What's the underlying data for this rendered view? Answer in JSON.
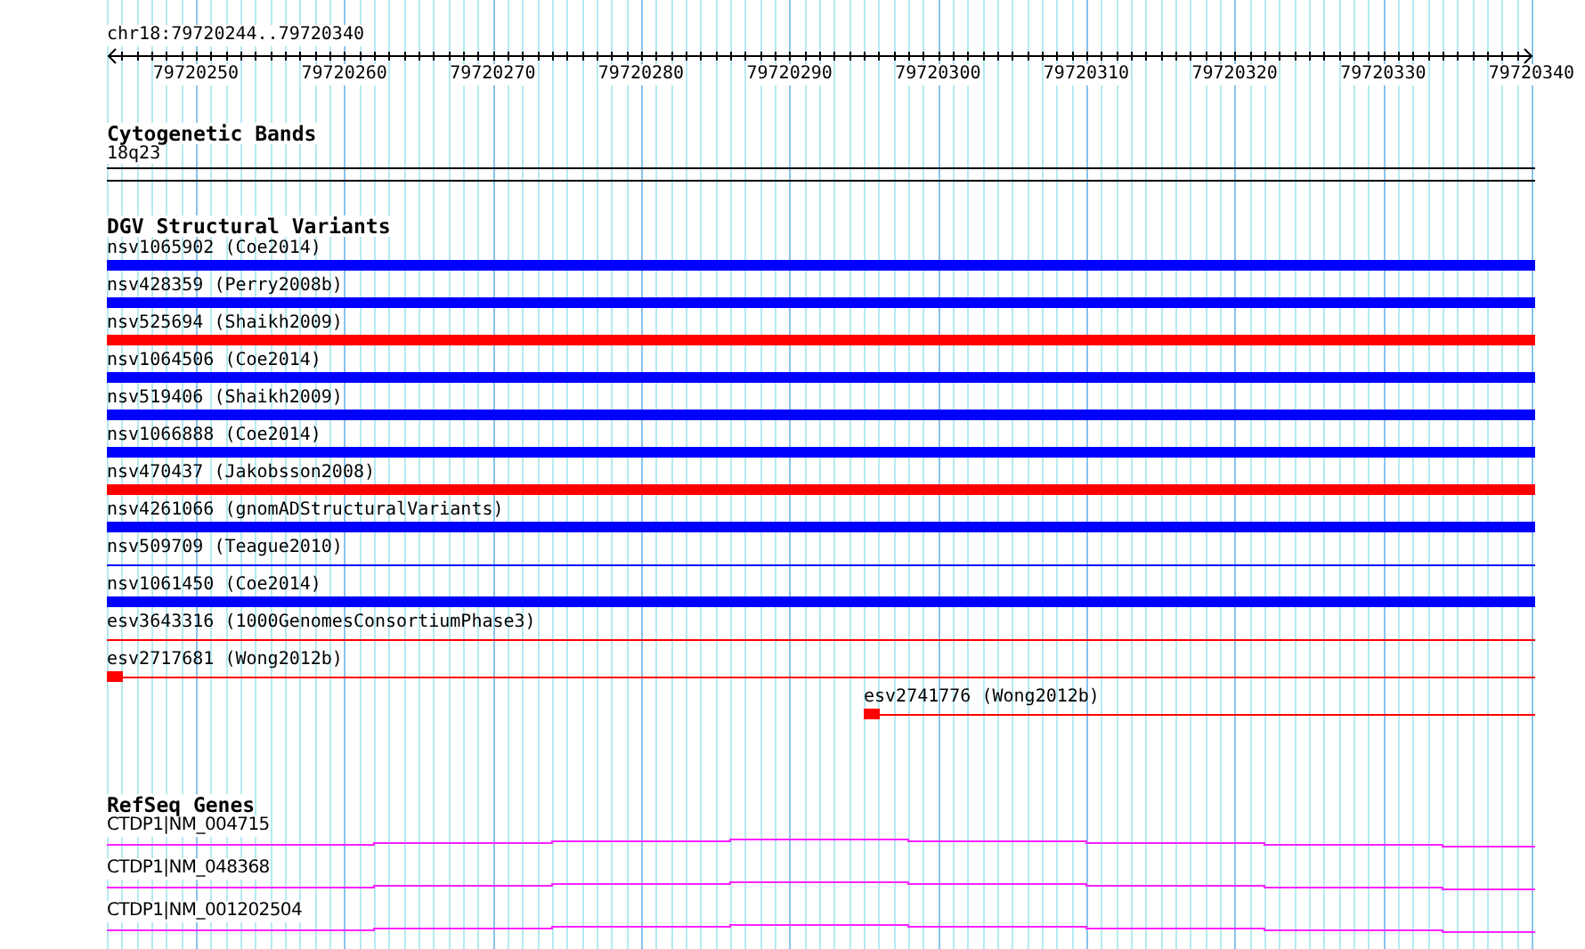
{
  "location": "chr18:79720244..79720340",
  "ruler": {
    "ticks": [
      "79720250",
      "79720260",
      "79720270",
      "79720280",
      "79720290",
      "79720300",
      "79720310",
      "79720320",
      "79720330",
      "79720340"
    ]
  },
  "tracks": [
    {
      "title": "Cytogenetic Bands",
      "kind": "bands",
      "features": [
        {
          "label": "18q23"
        }
      ]
    },
    {
      "title": "DGV Structural Variants",
      "kind": "variants",
      "features": [
        {
          "label": "nsv1065902 (Coe2014)",
          "color": "#0000ff",
          "kind": "thick"
        },
        {
          "label": "nsv428359 (Perry2008b)",
          "color": "#0000ff",
          "kind": "thick"
        },
        {
          "label": "nsv525694 (Shaikh2009)",
          "color": "#ff0000",
          "kind": "thick"
        },
        {
          "label": "nsv1064506 (Coe2014)",
          "color": "#0000ff",
          "kind": "thick"
        },
        {
          "label": "nsv519406 (Shaikh2009)",
          "color": "#0000ff",
          "kind": "thick"
        },
        {
          "label": "nsv1066888 (Coe2014)",
          "color": "#0000ff",
          "kind": "thick"
        },
        {
          "label": "nsv470437 (Jakobsson2008)",
          "color": "#ff0000",
          "kind": "thick"
        },
        {
          "label": "nsv4261066 (gnomADStructuralVariants)",
          "color": "#0000ff",
          "kind": "thick"
        },
        {
          "label": "nsv509709 (Teague2010)",
          "color": "#0000ff",
          "kind": "thin"
        },
        {
          "label": "nsv1061450 (Coe2014)",
          "color": "#0000ff",
          "kind": "thick"
        },
        {
          "label": "esv3643316 (1000GenomesConsortiumPhase3)",
          "color": "#ff0000",
          "kind": "thin"
        },
        {
          "label": "esv2717681 (Wong2012b)",
          "color": "#ff0000",
          "kind": "block"
        },
        {
          "label": "esv2741776 (Wong2012b)",
          "color": "#ff0000",
          "kind": "block"
        }
      ]
    },
    {
      "title": "RefSeq Genes",
      "kind": "genes",
      "features": [
        {
          "label": "CTDP1|NM_004715"
        },
        {
          "label": "CTDP1|NM_048368"
        },
        {
          "label": "CTDP1|NM_001202504"
        }
      ]
    }
  ]
}
